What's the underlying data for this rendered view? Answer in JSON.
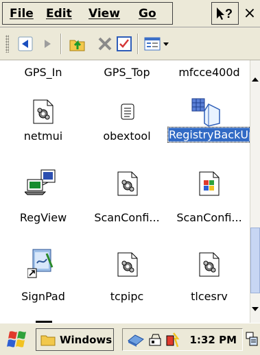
{
  "menubar": {
    "items": [
      "File",
      "Edit",
      "View",
      "Go"
    ],
    "help_icon": "whats-this-icon",
    "close_label": "×"
  },
  "toolbar": {
    "buttons": [
      "back-icon",
      "forward-icon",
      "up-folder-icon",
      "delete-icon",
      "properties-icon",
      "view-menu-icon"
    ]
  },
  "files": {
    "row0": [
      "GPS_In",
      "GPS_Top",
      "mfcce400d"
    ],
    "row1": [
      "netmui",
      "obextool",
      "RegistryBackUp"
    ],
    "row2": [
      "RegView",
      "ScanConfi...",
      "ScanConfi..."
    ],
    "row3": [
      "SignPad",
      "tcpipc",
      "tlcesrv"
    ]
  },
  "selected_item": "RegistryBackUp",
  "taskbar": {
    "active_window": "Windows",
    "clock": "1:32 PM"
  },
  "colors": {
    "selection": "#316ac5",
    "chrome": "#ece9d8"
  }
}
